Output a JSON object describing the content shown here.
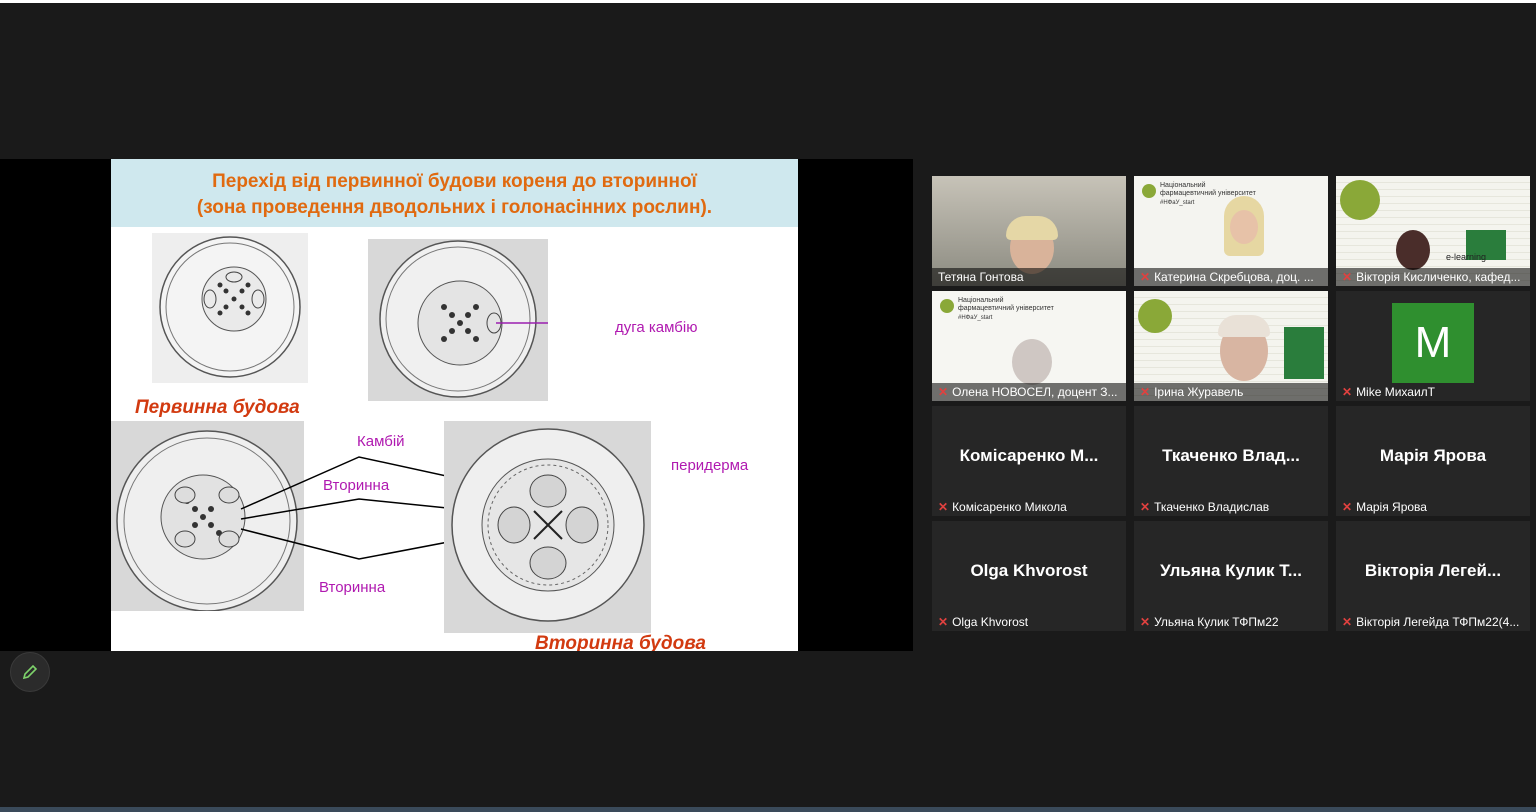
{
  "slide": {
    "title_line1": "Перехід від первинної будови кореня до вторинної",
    "title_line2": "(зона проведення дводольних і голонасінних рослин).",
    "caption_primary": "Первинна будова",
    "caption_secondary": "Вторинна будова",
    "label_arc": "дуга камбію",
    "label_cambium": "Камбій",
    "label_secondary1": "Вторинна",
    "label_secondary2": "Вторинна",
    "label_periderm": "перидерма"
  },
  "participants": [
    {
      "name": "Тетяна Гонтова",
      "display": "",
      "type": "video",
      "muted": false,
      "active": true
    },
    {
      "name": "Катерина Скребцова, доц. ...",
      "display": "",
      "type": "video",
      "muted": true
    },
    {
      "name": "Вікторія Кисличенко, кафед...",
      "display": "",
      "type": "video",
      "muted": true
    },
    {
      "name": "Олена НОВОСЕЛ, доцент З...",
      "display": "",
      "type": "video",
      "muted": true
    },
    {
      "name": "Ірина Журавель",
      "display": "",
      "type": "video",
      "muted": true
    },
    {
      "name": "Mike МихаилТ",
      "display": "M",
      "type": "avatar",
      "muted": true
    },
    {
      "name": "Комісаренко Микола",
      "display": "Комісаренко М...",
      "type": "name",
      "muted": true
    },
    {
      "name": "Ткаченко Владислав",
      "display": "Ткаченко Влад...",
      "type": "name",
      "muted": true
    },
    {
      "name": "Марія Ярова",
      "display": "Марія Ярова",
      "type": "name",
      "muted": true
    },
    {
      "name": "Olga Khvorost",
      "display": "Olga Khvorost",
      "type": "name",
      "muted": true
    },
    {
      "name": "Ульяна Кулик ТФПм22",
      "display": "Ульяна Кулик Т...",
      "type": "name",
      "muted": true
    },
    {
      "name": "Вікторія Легейда ТФПм22(4...",
      "display": "Вікторія Легей...",
      "type": "name",
      "muted": true
    }
  ],
  "tile_text": {
    "university": "Національний фармацевтичний університет",
    "hashtag": "#НФаУ_start",
    "elearning": "e-learning"
  },
  "colors": {
    "accent_active": "#c8e65a",
    "mic_off": "#e0413f",
    "avatar_green": "#2f8f2f",
    "title_orange": "#e06a10",
    "label_magenta": "#b019b0"
  }
}
